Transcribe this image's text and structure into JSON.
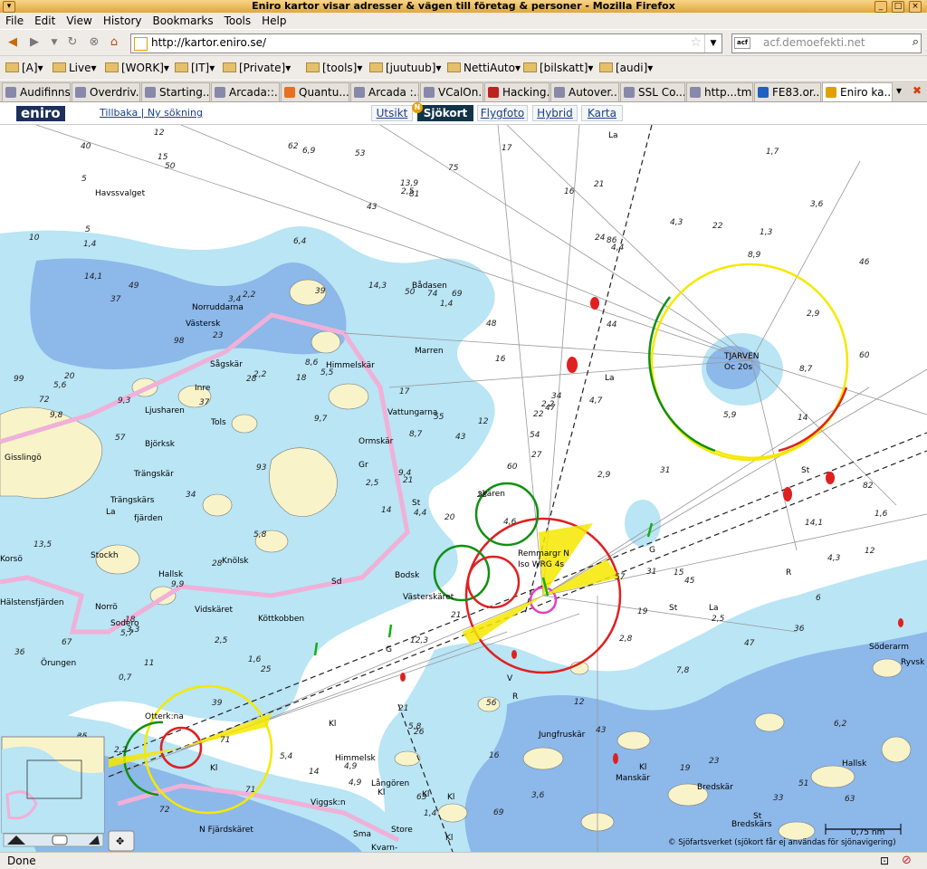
{
  "window": {
    "title": "Eniro kartor visar adresser & vägen till företag & personer - Mozilla Firefox"
  },
  "menu": [
    "File",
    "Edit",
    "View",
    "History",
    "Bookmarks",
    "Tools",
    "Help"
  ],
  "nav": {
    "url": "http://kartor.eniro.se/",
    "search_engine": "acf",
    "search_placeholder": "acf.demoefekti.net"
  },
  "bookmarks": [
    "[A]",
    "Live",
    "[WORK]",
    "[IT]",
    "[Private]",
    "[tools]",
    "[juutuub]",
    "NettiAuto",
    "[bilskatt]",
    "[audi]"
  ],
  "tabs": [
    "Audifinns",
    "Overdriv...",
    "Starting...",
    "Arcada::...",
    "Quantu...",
    "Arcada :...",
    "VCalOn...",
    "Hacking...",
    "Autover...",
    "SSL Co...",
    "http...tml",
    "FE83.or...",
    "Eniro ka..."
  ],
  "app": {
    "logo": "eniro",
    "back_link": "Tillbaka | Ny sökning",
    "map_tabs": [
      "Utsikt",
      "Sjökort",
      "Flygfoto",
      "Hybrid",
      "Karta"
    ],
    "selected_tab": "Sjökort",
    "new_badge": "N"
  },
  "map": {
    "place_names": [
      "Havssvalget",
      "Bådasen",
      "Norruddarna",
      "Västersk",
      "Sågskär",
      "Inre",
      "Ljusharen",
      "Tols",
      "Björksk",
      "Trängskär",
      "Gisslingö",
      "Trängskärs",
      "fjärden",
      "Stockh",
      "Korsö",
      "Norrö",
      "Sodero",
      "Hallsk",
      "Knölsk",
      "Vidskäret",
      "Köttkobben",
      "Örungen",
      "Otterk:na",
      "Himmelskär",
      "Marren",
      "Vattungarna",
      "Ormskär",
      "skären",
      "Bodsk",
      "Västerskäret",
      "Remmargr N",
      "Iso WRG 4s",
      "TJARVEN",
      "Oc 20s",
      "Jungfruskär",
      "Manskär",
      "Bredskär",
      "Bredskärs",
      "Söderarm",
      "Hallsk",
      "Himmelsk",
      "Långören",
      "Viggsk:n",
      "Sma",
      "Store",
      "Kvarn-",
      "N Fjärdskäret",
      "Ido",
      "Hu",
      "Hälstensfjärden",
      "Ryvsk"
    ],
    "depths": [
      "20",
      "37",
      "21",
      "35",
      "22",
      "25",
      "21",
      "69",
      "86",
      "60",
      "50",
      "63",
      "57",
      "46",
      "14",
      "44",
      "72",
      "50",
      "16",
      "11",
      "5,5",
      "7,7",
      "71",
      "74",
      "47",
      "45",
      "49",
      "81",
      "9,8",
      "57",
      "60",
      "9,4",
      "21",
      "8,7",
      "2,2",
      "4,3",
      "1,6",
      "33",
      "6,2",
      "15",
      "17",
      "18",
      "37",
      "2,8",
      "71",
      "99",
      "54",
      "13",
      "26",
      "27",
      "0,7",
      "2,9",
      "10",
      "19",
      "43",
      "39",
      "15",
      "40",
      "56",
      "1,3",
      "75",
      "93",
      "20",
      "23",
      "22",
      "12",
      "16",
      "43",
      "55",
      "36",
      "12,3",
      "14",
      "31",
      "28",
      "50",
      "5",
      "98",
      "13,5",
      "17",
      "16",
      "12",
      "2,2",
      "2,9",
      "6",
      "63",
      "14",
      "21",
      "23",
      "69",
      "12",
      "13,9",
      "1,6",
      "4,7",
      "7,8",
      "43",
      "36",
      "5,6",
      "1,4",
      "24",
      "4,4",
      "34",
      "62",
      "82",
      "72",
      "9,9",
      "2,5",
      "5,4",
      "2,2",
      "8,9",
      "9,7",
      "14,1",
      "1,4",
      "1,4",
      "2,5",
      "6,9",
      "67",
      "4,4",
      "3,6",
      "14,3",
      "53",
      "5,7",
      "1,7",
      "48",
      "39",
      "31",
      "28",
      "51",
      "4,9",
      "5,9",
      "14,1",
      "3,3",
      "3,6",
      "2,2",
      "6,4",
      "4,3",
      "2,5",
      "5,8",
      "18",
      "12",
      "8,6",
      "4,6",
      "9,3",
      "47",
      "22",
      "34",
      "5",
      "4,9",
      "19",
      "5,8",
      "2,5",
      "8,7",
      "3,4"
    ],
    "light_marks": [
      "La",
      "La",
      "St",
      "Gr",
      "St",
      "Sd",
      "La",
      "St",
      "G",
      "R",
      "G",
      "Kl",
      "Kl",
      "Kl",
      "Kl",
      "Kl",
      "R",
      "V",
      "Kl",
      "Kl",
      "St",
      "La"
    ],
    "scale_text": "0,75 nm",
    "copyright": "© Sjöfartsverket (sjökort får ej användas för sjönavigering)"
  },
  "status": {
    "text": "Done"
  },
  "colors": {
    "land": "#f8f3c9",
    "shallow": "#b9e5f5",
    "mid": "#8cb8ea",
    "sea": "#ffffff",
    "red": "#e02020",
    "green": "#109010",
    "yellow": "#f5e800"
  }
}
